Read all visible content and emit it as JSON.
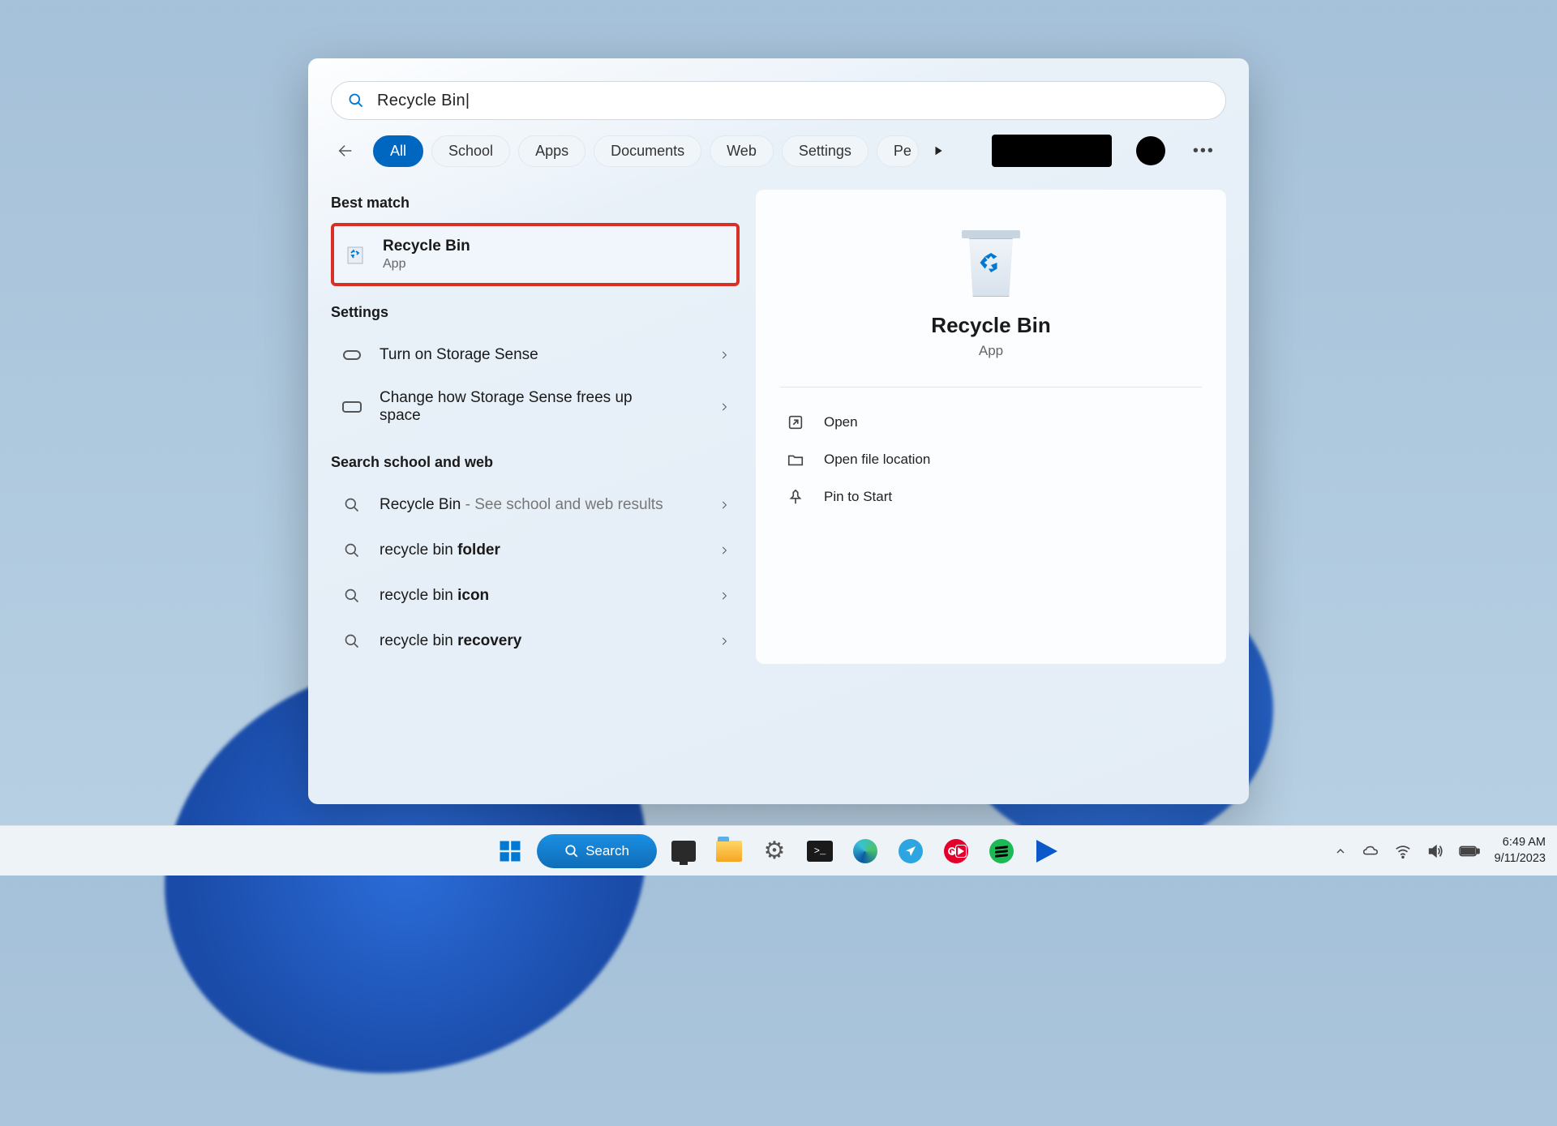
{
  "search": {
    "query": "Recycle Bin"
  },
  "filters": {
    "items": [
      "All",
      "School",
      "Apps",
      "Documents",
      "Web",
      "Settings",
      "Pe"
    ],
    "active_index": 0
  },
  "sections": {
    "best_match": "Best match",
    "settings": "Settings",
    "web": "Search school and web"
  },
  "best_match_item": {
    "title": "Recycle Bin",
    "subtitle": "App"
  },
  "settings_items": [
    {
      "title": "Turn on Storage Sense"
    },
    {
      "title": "Change how Storage Sense frees up space"
    }
  ],
  "web_items": [
    {
      "prefix": "Recycle Bin",
      "suffix": " - See school and web results"
    },
    {
      "prefix": "recycle bin ",
      "bold": "folder"
    },
    {
      "prefix": "recycle bin ",
      "bold": "icon"
    },
    {
      "prefix": "recycle bin ",
      "bold": "recovery"
    }
  ],
  "preview": {
    "title": "Recycle Bin",
    "type": "App"
  },
  "actions": [
    {
      "label": "Open"
    },
    {
      "label": "Open file location"
    },
    {
      "label": "Pin to Start"
    }
  ],
  "taskbar": {
    "search_label": "Search"
  },
  "clock": {
    "time": "6:49 AM",
    "date": "9/11/2023"
  }
}
